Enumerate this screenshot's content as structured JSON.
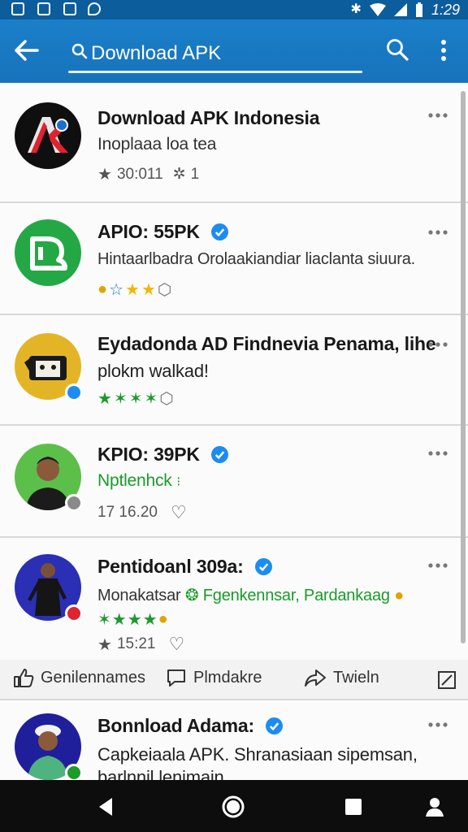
{
  "statusbar": {
    "time": "1:29"
  },
  "appbar": {
    "query": "Download APK"
  },
  "items": [
    {
      "title": "Download APK Indonesia",
      "subtitle": "Inoplaaa loa tea",
      "meta": "30:011",
      "meta2": "1"
    },
    {
      "title": "APIO: 55PK",
      "subtitle": "Hintaarlbadra Orolaakiandiar liaclanta siuura."
    },
    {
      "title": "Eydadonda AD Findnevia Penama, lihe",
      "subtitle": "plokm walkad!"
    },
    {
      "title": "KPIO: 39PK",
      "subtitle": "Nptlenhck",
      "meta": "17 16.20"
    },
    {
      "title": "Pentidoanl 309a:",
      "subtitle_a": "Monakatsar",
      "subtitle_b": "Fgenkennsar, Pardankaag",
      "meta": "15:21"
    },
    {
      "title": "Bonnload Adama:",
      "subtitle": "Capkeiaala APK. Shranasiaan sipemsan,",
      "subtitle2": "barlnnil lenimain"
    }
  ],
  "actions": {
    "like": "Genilennames",
    "comment": "Plmdakre",
    "share": "Twieln"
  },
  "colors": {
    "appbar": "#1a7fc9",
    "verified": "#1d8cf0",
    "star_gold": "#f2b705",
    "star_green": "#1c9a2a"
  }
}
